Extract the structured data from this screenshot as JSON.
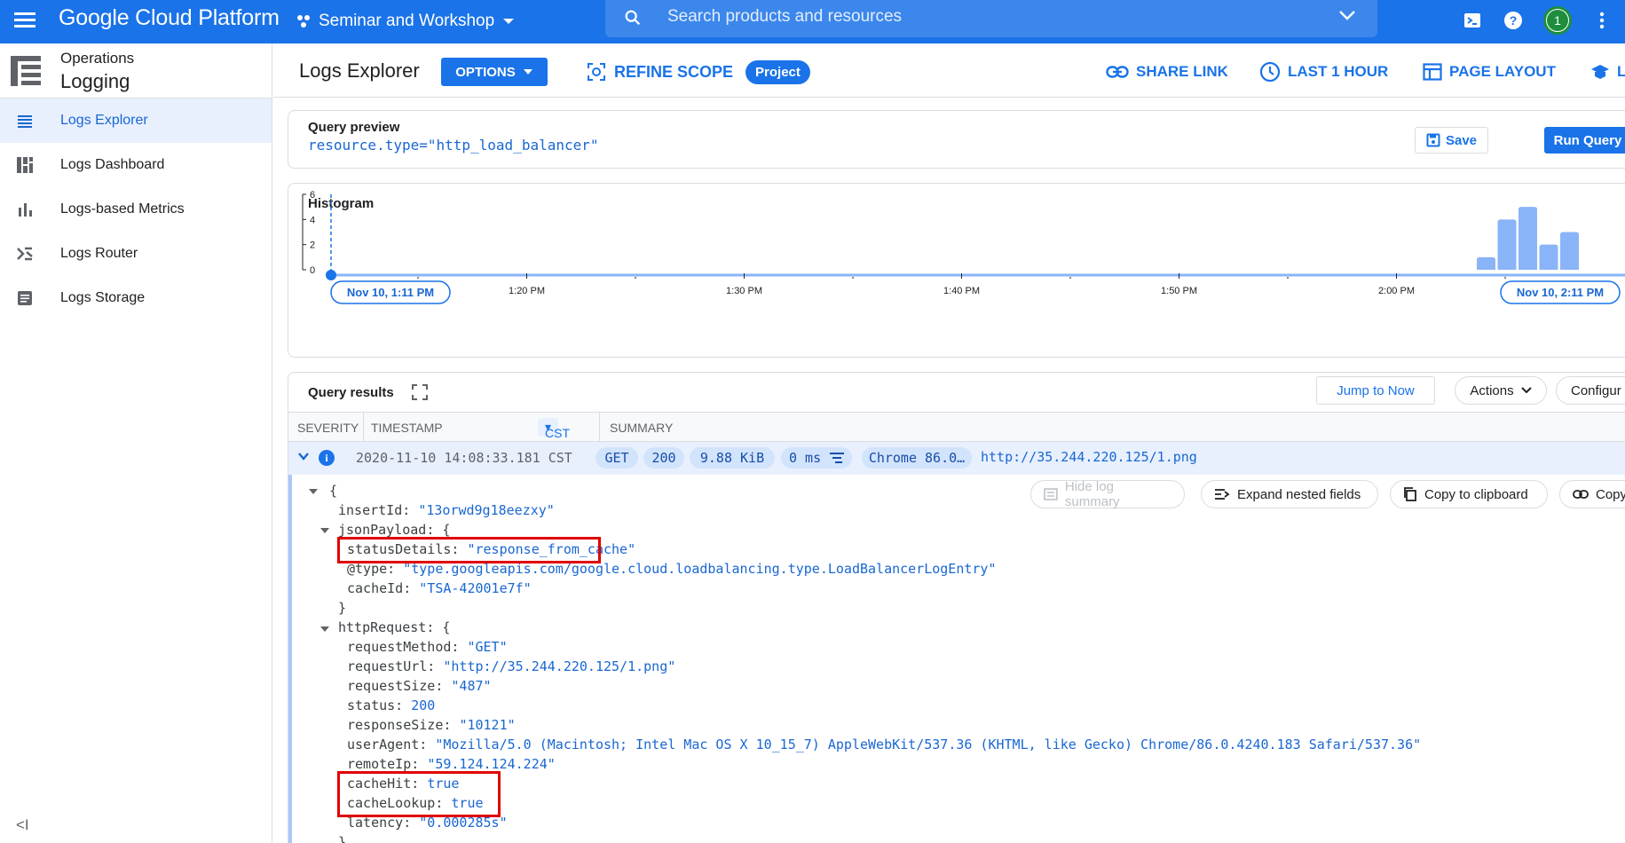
{
  "topbar": {
    "brand": "Google Cloud Platform",
    "project": "Seminar and Workshop",
    "search_placeholder": "Search products and resources",
    "avatar_initial": "1"
  },
  "sidebar": {
    "section": "Operations",
    "product": "Logging",
    "items": [
      {
        "label": "Logs Explorer",
        "icon": "list-icon",
        "active": true
      },
      {
        "label": "Logs Dashboard",
        "icon": "dashboard-icon"
      },
      {
        "label": "Logs-based Metrics",
        "icon": "bar-chart-icon"
      },
      {
        "label": "Logs Router",
        "icon": "router-icon"
      },
      {
        "label": "Logs Storage",
        "icon": "storage-icon"
      }
    ]
  },
  "toolbar": {
    "title": "Logs Explorer",
    "options": "OPTIONS",
    "refine_scope": "REFINE SCOPE",
    "scope_chip": "Project",
    "share_link": "SHARE LINK",
    "time_range": "LAST 1 HOUR",
    "page_layout": "PAGE LAYOUT",
    "truncated": "LI"
  },
  "query_preview": {
    "title": "Query preview",
    "query": "resource.type=\"http_load_balancer\"",
    "save": "Save",
    "run": "Run Query"
  },
  "histogram": {
    "title": "Histogram",
    "y_ticks": [
      "6",
      "4",
      "2",
      "0"
    ],
    "x_ticks": [
      "1:20 PM",
      "1:30 PM",
      "1:40 PM",
      "1:50 PM",
      "2:00 PM"
    ],
    "start_label": "Nov 10, 1:11 PM",
    "end_label": "Nov 10, 2:11 PM",
    "bars": [
      1,
      4,
      5,
      2,
      3
    ],
    "bar_color": "#8ab4f8"
  },
  "results": {
    "title": "Query results",
    "jump_to_now": "Jump to Now",
    "actions": "Actions",
    "configure": "Configur",
    "columns": {
      "severity": "SEVERITY",
      "timestamp": "TIMESTAMP",
      "tz": "CST",
      "summary": "SUMMARY"
    },
    "row": {
      "timestamp": "2020-11-10 14:08:33.181 CST",
      "method": "GET",
      "status": "200",
      "size": "9.88 KiB",
      "latency": "0 ms",
      "agent": "Chrome 86.0…",
      "url": "http://35.244.220.125/1.png"
    },
    "detail_buttons": {
      "hide_summary": "Hide log summary",
      "expand_nested": "Expand nested fields",
      "copy_clipboard": "Copy to clipboard",
      "copy_link": "Copy l"
    },
    "json": {
      "open": "{",
      "insertId_k": "insertId: ",
      "insertId_v": "\"13orwd9g18eezxy\"",
      "jsonPayload_k": "jsonPayload: {",
      "statusDetails_k": "statusDetails: ",
      "statusDetails_v": "\"response_from_cache\"",
      "type_k": "@type: ",
      "type_v": "\"type.googleapis.com/google.cloud.loadbalancing.type.LoadBalancerLogEntry\"",
      "cacheId_k": "cacheId: ",
      "cacheId_v": "\"TSA-42001e7f\"",
      "close": "}",
      "httpRequest_k": "httpRequest: {",
      "requestMethod_k": "requestMethod: ",
      "requestMethod_v": "\"GET\"",
      "requestUrl_k": "requestUrl: ",
      "requestUrl_v": "\"http://35.244.220.125/1.png\"",
      "requestSize_k": "requestSize: ",
      "requestSize_v": "\"487\"",
      "status_k": "status: ",
      "status_v": "200",
      "responseSize_k": "responseSize: ",
      "responseSize_v": "\"10121\"",
      "userAgent_k": "userAgent: ",
      "userAgent_v": "\"Mozilla/5.0 (Macintosh; Intel Mac OS X 10_15_7) AppleWebKit/537.36 (KHTML, like Gecko) Chrome/86.0.4240.183 Safari/537.36\"",
      "remoteIp_k": "remoteIp: ",
      "remoteIp_v": "\"59.124.124.224\"",
      "cacheHit_k": "cacheHit: ",
      "cacheHit_v": "true",
      "cacheLookup_k": "cacheLookup: ",
      "cacheLookup_v": "true",
      "latency_k": "latency: ",
      "latency_v": "\"0.000285s\""
    }
  },
  "colors": {
    "primary": "#1a73e8",
    "highlight": "#e00000"
  }
}
